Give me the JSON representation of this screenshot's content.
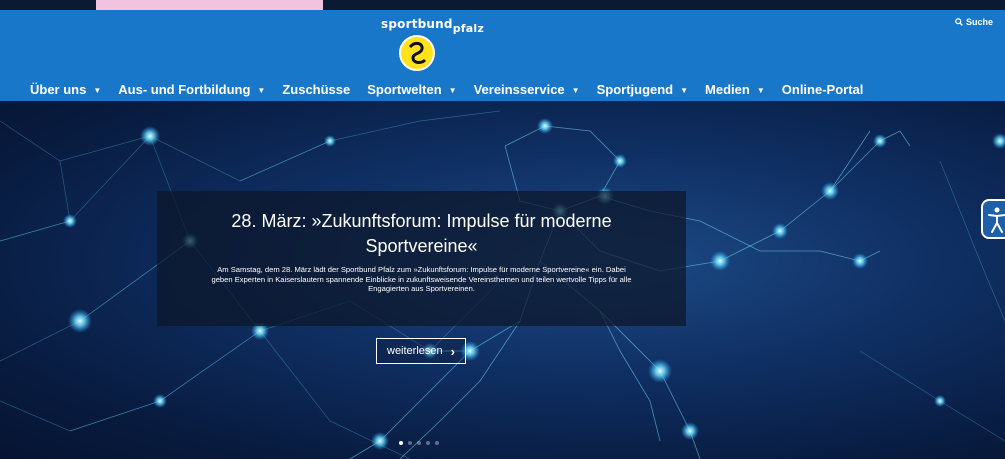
{
  "logo": {
    "brand": "sportbund",
    "sub": "pfalz"
  },
  "search": {
    "label": "Suche"
  },
  "nav": {
    "items": [
      {
        "label": "Über uns",
        "dropdown": true
      },
      {
        "label": "Aus- und Fortbildung",
        "dropdown": true
      },
      {
        "label": "Zuschüsse",
        "dropdown": false
      },
      {
        "label": "Sportwelten",
        "dropdown": true
      },
      {
        "label": "Vereinsservice",
        "dropdown": true
      },
      {
        "label": "Sportjugend",
        "dropdown": true
      },
      {
        "label": "Medien",
        "dropdown": true
      },
      {
        "label": "Online-Portal",
        "dropdown": false
      }
    ]
  },
  "hero": {
    "title_line1": "28. März: »Zukunftsforum: Impulse für moderne",
    "title_line2": "Sportvereine«",
    "text_line1": "Am Samstag, dem 28. März lädt der Sportbund Pfalz zum »Zukunftsforum: Impulse für moderne Sportvereine« ein. Dabei",
    "text_line2": "geben Experten in Kaiserslautern spannende Einblicke in zukunftsweisende Vereinsthemen und teilen wertvolle Tipps für alle",
    "text_line3": "Engagierten aus Sportvereinen.",
    "readmore": "weiterlesen",
    "slides": 5,
    "active_slide": 1
  },
  "colors": {
    "header": "#1877c8",
    "pink": "#f2c3df",
    "logo_ball": "#ffe21a"
  },
  "icons": {
    "search": "search-icon",
    "accessibility": "accessibility-icon",
    "chevron": "chevron-right-icon"
  }
}
